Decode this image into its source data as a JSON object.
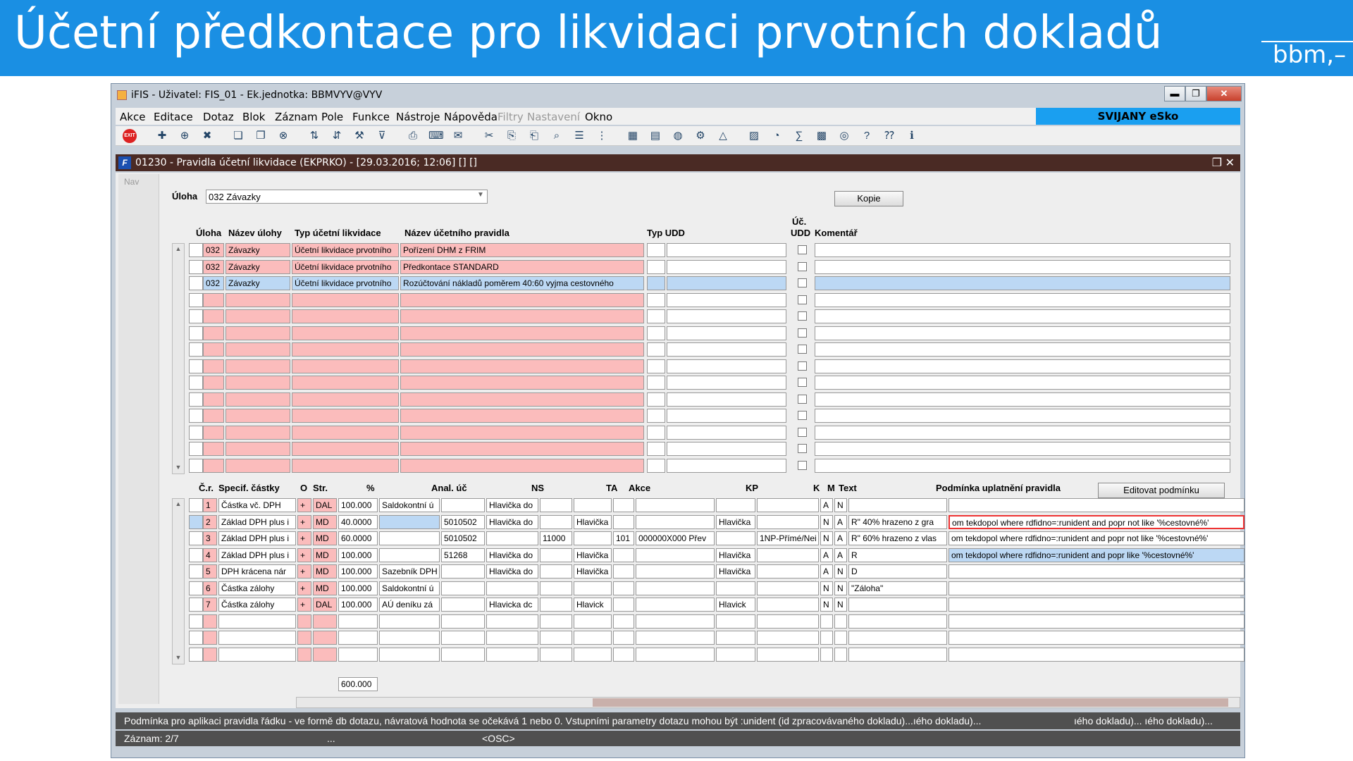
{
  "slide": {
    "title": "Účetní předkontace pro likvidaci prvotních dokladů",
    "brand": "bbm,–"
  },
  "window": {
    "title": "iFIS - Uživatel: FIS_01 - Ek.jednotka: BBMVYV@VYV",
    "min": "▬",
    "max": "❐",
    "close": "✕"
  },
  "menu": [
    "Akce",
    "Editace",
    "Dotaz",
    "Blok",
    "Záznam",
    "Pole",
    "Funkce",
    "Nástroje",
    "Nápověda",
    "Filtry",
    "Nastavení",
    "Okno"
  ],
  "company": "SVIJANY eSko",
  "form": {
    "title": "01230 - Pravidla účetní likvidace (EKPRKO) - [29.03.2016; 12:06] [] []",
    "logo": "F",
    "controls": "❐ ✕"
  },
  "nav": "Nav",
  "uloha": {
    "label": "Úloha",
    "value": "032 Závazky"
  },
  "kopie": "Kopie",
  "top_headers": {
    "uloha": "Úloha",
    "nazev_ulohy": "Název úlohy",
    "typ": "Typ účetní likvidace",
    "nazev_pravidla": "Název účetního pravidla",
    "typ_udd": "Typ UDD",
    "uc": "Úč.",
    "udd": "UDD",
    "komentar": "Komentář"
  },
  "top_rows": [
    {
      "uloha": "032",
      "nazev": "Závazky",
      "typ": "Účetní likvidace prvotního",
      "pravidlo": "Pořízení DHM z FRIM"
    },
    {
      "uloha": "032",
      "nazev": "Závazky",
      "typ": "Účetní likvidace prvotního",
      "pravidlo": "Předkontace STANDARD"
    },
    {
      "uloha": "032",
      "nazev": "Závazky",
      "typ": "Účetní likvidace prvotního",
      "pravidlo": "Rozúčtování nákladů poměrem 40:60 vyjma cestovného"
    }
  ],
  "bottom_headers": {
    "cr": "Č.r.",
    "specif": "Specif. částky",
    "o": "O",
    "str": "Str.",
    "pct": "%",
    "anal": "Anal. úč",
    "ns": "NS",
    "ta": "TA",
    "akce": "Akce",
    "kp": "KP",
    "k": "K",
    "m": "M",
    "text": "Text",
    "podminka": "Podmínka uplatnění pravidla"
  },
  "edit_btn": "Editovat podmínku",
  "bottom_rows": [
    {
      "cr": "1",
      "spec": "Částka vč. DPH",
      "o": "+",
      "str": "DAL",
      "pct": "100.000",
      "c1": "Saldokontní ú",
      "anal": "",
      "c2": "Hlavička do",
      "ns": "",
      "c3": "",
      "ta": "",
      "akce": "",
      "c4": "",
      "kp": "",
      "k": "A",
      "m": "N",
      "text": "",
      "podm": ""
    },
    {
      "cr": "2",
      "spec": "Základ DPH plus i",
      "o": "+",
      "str": "MD",
      "pct": "40.0000",
      "c1": "",
      "anal": "5010502",
      "c2": "Hlavička do",
      "ns": "",
      "c3": "Hlavička",
      "ta": "",
      "akce": "",
      "c4": "Hlavička",
      "kp": "",
      "k": "N",
      "m": "A",
      "text": "R\" 40% hrazeno z gra",
      "podm": "om tekdopol where rdfidno=:runident and popr not like '%cestovné%'"
    },
    {
      "cr": "3",
      "spec": "Základ DPH plus i",
      "o": "+",
      "str": "MD",
      "pct": "60.0000",
      "c1": "",
      "anal": "5010502",
      "c2": "",
      "ns": "11000",
      "c3": "",
      "ta": "101",
      "akce": "000000X000 Přev",
      "c4": "",
      "kp": "1NP-Přímé/Nei",
      "k": "N",
      "m": "A",
      "text": "R\" 60% hrazeno z vlas",
      "podm": "om tekdopol where rdfidno=:runident and popr not like '%cestovné%'"
    },
    {
      "cr": "4",
      "spec": "Základ DPH plus i",
      "o": "+",
      "str": "MD",
      "pct": "100.000",
      "c1": "",
      "anal": "51268",
      "c2": "Hlavička do",
      "ns": "",
      "c3": "Hlavička",
      "ta": "",
      "akce": "",
      "c4": "Hlavička",
      "kp": "",
      "k": "A",
      "m": "A",
      "text": "R",
      "podm": "om tekdopol where rdfidno=:runident and popr like '%cestovné%'"
    },
    {
      "cr": "5",
      "spec": "DPH krácena nár",
      "o": "+",
      "str": "MD",
      "pct": "100.000",
      "c1": "Sazebník DPH",
      "anal": "",
      "c2": "Hlavička do",
      "ns": "",
      "c3": "Hlavička",
      "ta": "",
      "akce": "",
      "c4": "Hlavička",
      "kp": "",
      "k": "A",
      "m": "N",
      "text": "D",
      "podm": ""
    },
    {
      "cr": "6",
      "spec": "Částka zálohy",
      "o": "+",
      "str": "MD",
      "pct": "100.000",
      "c1": "Saldokontní ú",
      "anal": "",
      "c2": "",
      "ns": "",
      "c3": "",
      "ta": "",
      "akce": "",
      "c4": "",
      "kp": "",
      "k": "N",
      "m": "N",
      "text": "\"Záloha\"",
      "podm": ""
    },
    {
      "cr": "7",
      "spec": "Částka zálohy",
      "o": "+",
      "str": "DAL",
      "pct": "100.000",
      "c1": "AÚ deníku zá",
      "anal": "",
      "c2": "Hlavicka dc",
      "ns": "",
      "c3": "Hlavick",
      "ta": "",
      "akce": "",
      "c4": "Hlavick",
      "kp": "",
      "k": "N",
      "m": "N",
      "text": "",
      "podm": ""
    }
  ],
  "sum": "600.000",
  "status": {
    "hint": "Podmínka pro aplikaci pravidla řádku - ve formě db dotazu, návratová hodnota se očekává 1 nebo 0. Vstupními parametry dotazu mohou být :unident (id zpracovávaného dokladu)...ıého dokladu)...",
    "hint2": "ıého dokladu)... ıého dokladu)...",
    "record": "Záznam: 2/7",
    "dots": "...",
    "osc": "<OSC>"
  }
}
